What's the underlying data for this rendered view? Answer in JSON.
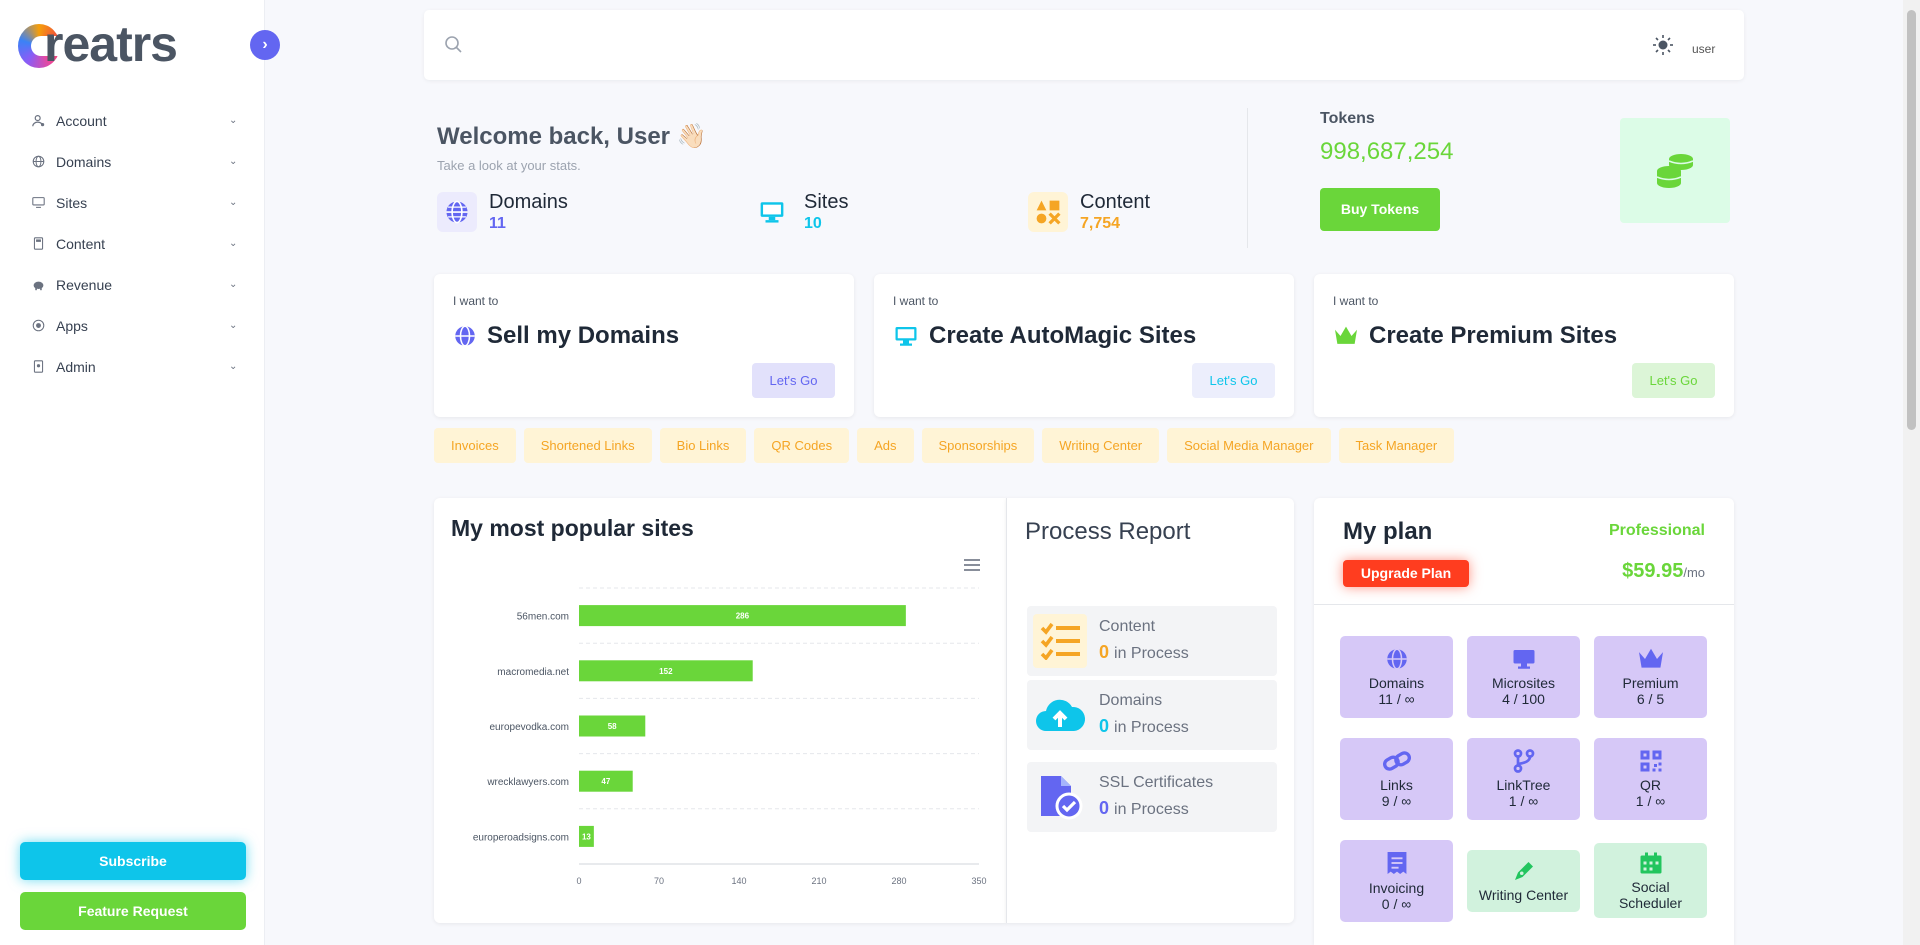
{
  "app": {
    "logo_text": "creatrs",
    "collapse_icon": "chevron-right-icon"
  },
  "sidebar": {
    "items": [
      {
        "label": "Account",
        "icon": "user-icon"
      },
      {
        "label": "Domains",
        "icon": "globe-icon"
      },
      {
        "label": "Sites",
        "icon": "monitor-icon"
      },
      {
        "label": "Content",
        "icon": "document-icon"
      },
      {
        "label": "Revenue",
        "icon": "piggy-bank-icon"
      },
      {
        "label": "Apps",
        "icon": "apps-icon"
      },
      {
        "label": "Admin",
        "icon": "admin-icon"
      }
    ],
    "subscribe_label": "Subscribe",
    "feature_label": "Feature Request"
  },
  "topbar": {
    "search_placeholder": "",
    "avatar_alt": "user"
  },
  "welcome": {
    "title": "Welcome back, User 👋🏻",
    "subtitle": "Take a look at your stats."
  },
  "stats": [
    {
      "label": "Domains",
      "value": "11",
      "color": "#6366f1"
    },
    {
      "label": "Sites",
      "value": "10",
      "color": "#0ec5ea"
    },
    {
      "label": "Content",
      "value": "7,754",
      "color": "#f5a524"
    }
  ],
  "tokens": {
    "label": "Tokens",
    "value": "998,687,254",
    "button": "Buy Tokens"
  },
  "actions": [
    {
      "small": "I want to",
      "title": "Sell my Domains",
      "button": "Let's Go"
    },
    {
      "small": "I want to",
      "title": "Create AutoMagic Sites",
      "button": "Let's Go"
    },
    {
      "small": "I want to",
      "title": "Create Premium Sites",
      "button": "Let's Go"
    }
  ],
  "quick_links": [
    "Invoices",
    "Shortened Links",
    "Bio Links",
    "QR Codes",
    "Ads",
    "Sponsorships",
    "Writing Center",
    "Social Media Manager",
    "Task Manager"
  ],
  "popular": {
    "title": "My most popular sites"
  },
  "chart_data": {
    "type": "bar",
    "orientation": "horizontal",
    "title": "My most popular sites",
    "categories": [
      "56men.com",
      "macromedia.net",
      "europevodka.com",
      "wrecklawyers.com",
      "europeroadsigns.com"
    ],
    "values": [
      286,
      152,
      58,
      47,
      13
    ],
    "xlim": [
      0,
      350
    ],
    "xticks": [
      0,
      70,
      140,
      210,
      280,
      350
    ],
    "bar_color": "#6ad63a",
    "grid": true
  },
  "process": {
    "title": "Process Report",
    "items": [
      {
        "label": "Content",
        "value": "0",
        "suffix": "in Process",
        "color": "#f5a524"
      },
      {
        "label": "Domains",
        "value": "0",
        "suffix": "in Process",
        "color": "#0ec5ea"
      },
      {
        "label": "SSL Certificates",
        "value": "0",
        "suffix": "in Process",
        "color": "#6366f1"
      }
    ]
  },
  "plan": {
    "title": "My plan",
    "name": "Professional",
    "upgrade": "Upgrade Plan",
    "price": "$59.95",
    "price_unit": "/mo",
    "tiles": [
      {
        "label": "Domains",
        "value": "11 / ∞",
        "icon": "globe-icon"
      },
      {
        "label": "Microsites",
        "value": "4 / 100",
        "icon": "monitor-icon"
      },
      {
        "label": "Premium",
        "value": "6 / 5",
        "icon": "crown-icon"
      },
      {
        "label": "Links",
        "value": "9 / ∞",
        "icon": "link-icon"
      },
      {
        "label": "LinkTree",
        "value": "1 / ∞",
        "icon": "branch-icon"
      },
      {
        "label": "QR",
        "value": "1 / ∞",
        "icon": "qr-icon"
      },
      {
        "label": "Invoicing",
        "value": "0 / ∞",
        "icon": "receipt-icon"
      },
      {
        "label": "Writing Center",
        "value": "",
        "icon": "pen-icon"
      },
      {
        "label": "Social Scheduler",
        "value": "",
        "icon": "calendar-icon"
      }
    ]
  },
  "colors": {
    "accent": "#6366f1",
    "green": "#6ad63a",
    "cyan": "#0ec5ea",
    "orange": "#f5a524",
    "red": "#ff3d1f"
  }
}
